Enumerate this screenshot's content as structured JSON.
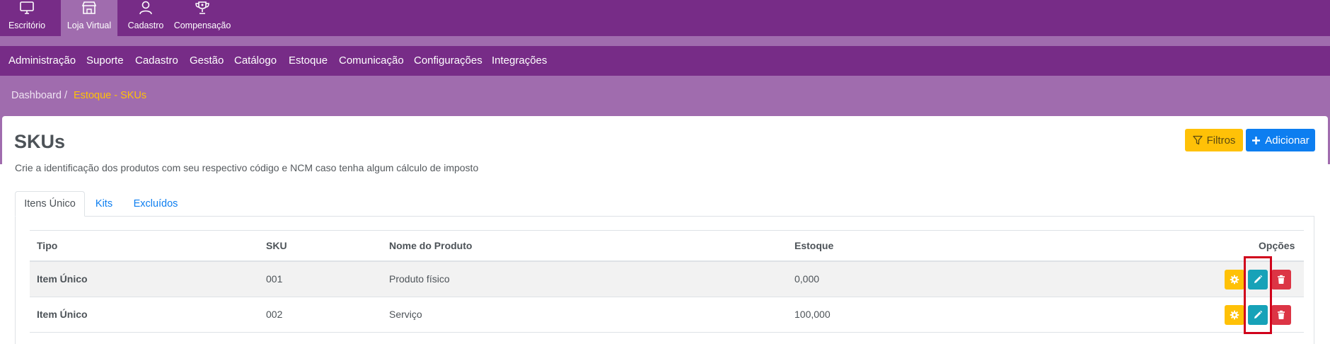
{
  "modules": [
    {
      "label": "Escritório",
      "icon": "monitor-icon",
      "active": false
    },
    {
      "label": "Loja Virtual",
      "icon": "store-icon",
      "active": true
    },
    {
      "label": "Cadastro",
      "icon": "user-icon",
      "active": false
    },
    {
      "label": "Compensação",
      "icon": "trophy-icon",
      "active": false
    }
  ],
  "menu": [
    "Administração",
    "Suporte",
    "Cadastro",
    "Gestão",
    "Catálogo",
    "Estoque",
    "Comunicação",
    "Configurações",
    "Integrações"
  ],
  "breadcrumb": {
    "root": "Dashboard",
    "separator": "/",
    "current": "Estoque - SKUs"
  },
  "page": {
    "title": "SKUs",
    "subtitle": "Crie a identificação dos produtos com seu respectivo código e NCM caso tenha algum cálculo de imposto"
  },
  "actions": {
    "filter_label": "Filtros",
    "add_label": "Adicionar"
  },
  "tabs": [
    {
      "label": "Itens Único",
      "active": true
    },
    {
      "label": "Kits",
      "active": false
    },
    {
      "label": "Excluídos",
      "active": false
    }
  ],
  "table": {
    "headers": {
      "tipo": "Tipo",
      "sku": "SKU",
      "nome": "Nome do Produto",
      "estoque": "Estoque",
      "opcoes": "Opções"
    },
    "rows": [
      {
        "tipo": "Item Único",
        "sku": "001",
        "nome": "Produto físico",
        "estoque": "0,000"
      },
      {
        "tipo": "Item Único",
        "sku": "002",
        "nome": "Serviço",
        "estoque": "100,000"
      }
    ]
  },
  "colors": {
    "header_purple": "#772c87",
    "light_purple": "#a06cae",
    "breadcrumb_active": "#ffc107",
    "primary": "#0d7ef0",
    "warning": "#ffc107",
    "info": "#17a2b8",
    "danger": "#dc3545",
    "highlight": "#d0021b"
  }
}
